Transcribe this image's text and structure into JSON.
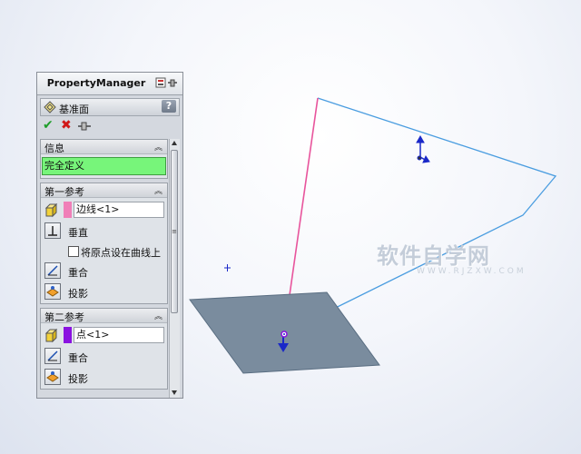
{
  "panel": {
    "title": "PropertyManager",
    "feature_name": "基准面",
    "help_label": "?"
  },
  "info_group": {
    "title": "信息",
    "status": "完全定义"
  },
  "first_reference": {
    "title": "第一参考",
    "selection": "边线<1>",
    "selection_color": "#f07fb8",
    "options": [
      "垂直",
      "重合",
      "投影"
    ],
    "checkbox_label": "将原点设在曲线上",
    "checkbox_checked": false
  },
  "second_reference": {
    "title": "第二参考",
    "selection": "点<1>",
    "selection_color": "#8a12e0",
    "options": [
      "重合",
      "投影"
    ]
  },
  "watermark": {
    "text": "软件自学网",
    "url": "WWW.RJZXW.COM"
  },
  "colors": {
    "status_green": "#77f57a",
    "plane_fill": "#7a8c9e",
    "curve_blue": "#4a9de0",
    "edge_pink": "#e8549c",
    "triad_blue": "#1a28c8"
  }
}
